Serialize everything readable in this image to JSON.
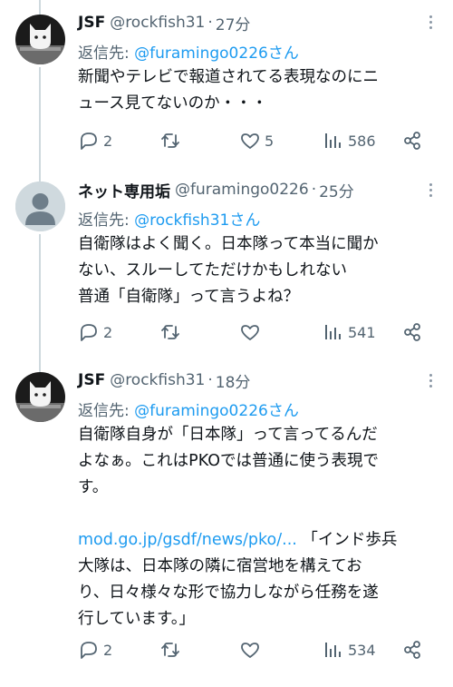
{
  "tweets": [
    {
      "name": "JSF",
      "handle": "@rockfish31",
      "dot": "·",
      "time": "27分",
      "reply_prefix": "返信先: ",
      "reply_to": "@furamingo0226さん",
      "lines": [
        "新聞やテレビで報道されてる表現なのにニ",
        "ュース見てないのか・・・"
      ],
      "replies": "2",
      "retweets": "",
      "likes": "5",
      "views": "586",
      "avatar": "cat-avatar"
    },
    {
      "name": "ネット専用垢",
      "handle": "@furamingo0226",
      "dot": "·",
      "time": "25分",
      "reply_prefix": "返信先: ",
      "reply_to": "@rockfish31さん",
      "lines": [
        "自衛隊はよく聞く。日本隊って本当に聞か",
        "ない、スルーしてただけかもしれない",
        "普通「自衛隊」って言うよね？"
      ],
      "replies": "2",
      "retweets": "",
      "likes": "",
      "views": "541",
      "avatar": "default-avatar"
    },
    {
      "name": "JSF",
      "handle": "@rockfish31",
      "dot": "·",
      "time": "18分",
      "reply_prefix": "返信先: ",
      "reply_to": "@furamingo0226さん",
      "lines": [
        "自衛隊自身が「日本隊」って言ってるんだ",
        "よなぁ。これはPKOでは普通に使う表現で",
        "す。",
        ""
      ],
      "link": "mod.go.jp/gsdf/news/pko/...",
      "link_after": " 「インド歩兵",
      "lines2": [
        "大隊は、日本隊の隣に宿営地を構えてお",
        "り、日々様々な形で協力しながら任務を遂",
        "行しています。」"
      ],
      "replies": "2",
      "retweets": "",
      "likes": "",
      "views": "534",
      "avatar": "cat-avatar"
    }
  ],
  "icons": {
    "reply": "reply-icon",
    "retweet": "retweet-icon",
    "like": "heart-icon",
    "views": "views-icon",
    "share": "share-icon"
  },
  "colors": {
    "link": "#1d9bf0",
    "secondary": "#536471",
    "line": "#cfd9de"
  }
}
